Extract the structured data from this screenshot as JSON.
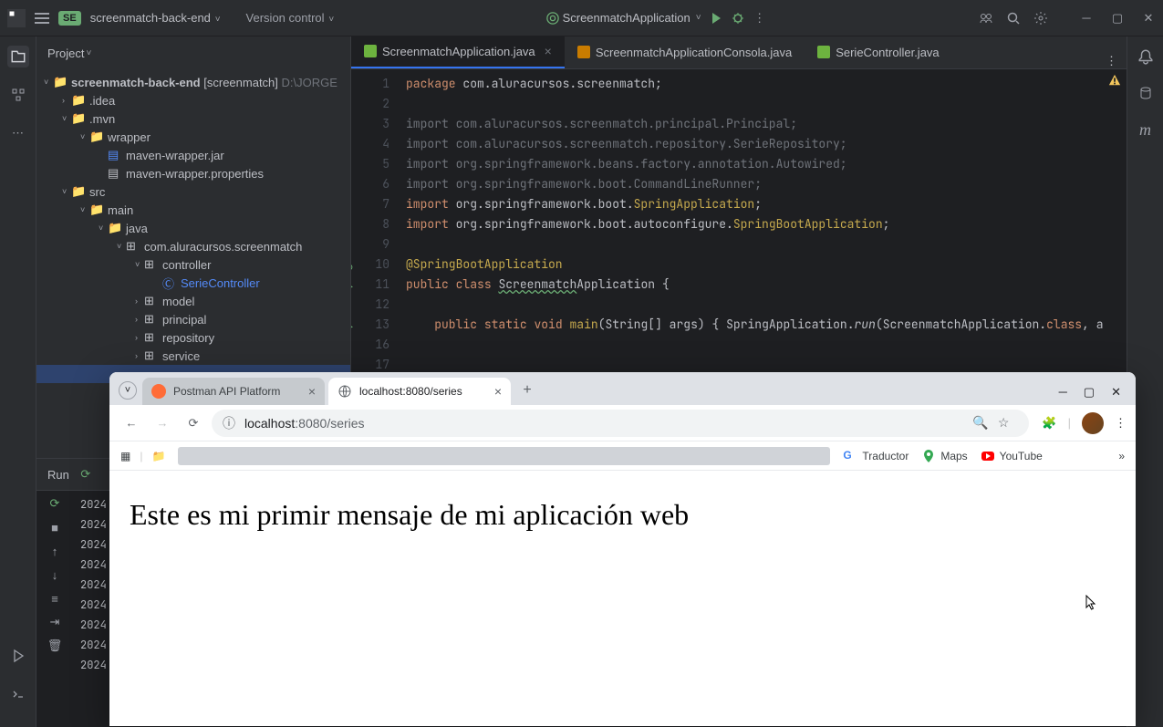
{
  "titlebar": {
    "se_badge": "SE",
    "project_name": "screenmatch-back-end",
    "version_control": "Version control",
    "run_config": "ScreenmatchApplication"
  },
  "project_panel": {
    "header": "Project",
    "root_name": "screenmatch-back-end",
    "root_suffix": "[screenmatch]",
    "root_path": "D:\\JORGE",
    "tree": {
      "idea": ".idea",
      "mvn": ".mvn",
      "wrapper": "wrapper",
      "maven_jar": "maven-wrapper.jar",
      "maven_props": "maven-wrapper.properties",
      "src": "src",
      "main": "main",
      "java": "java",
      "pkg": "com.aluracursos.screenmatch",
      "controller": "controller",
      "serie_controller": "SerieController",
      "model": "model",
      "principal": "principal",
      "repository": "repository",
      "service": "service"
    }
  },
  "editor_tabs": {
    "tab1": "ScreenmatchApplication.java",
    "tab2": "ScreenmatchApplicationConsola.java",
    "tab3": "SerieController.java"
  },
  "code": {
    "l1_kw": "package",
    "l1_pkg": " com.aluracursos.screenmatch",
    "l1_semi": ";",
    "l3": "import com.aluracursos.screenmatch.principal.Principal;",
    "l4": "import com.aluracursos.screenmatch.repository.SerieRepository;",
    "l5": "import org.springframework.beans.factory.annotation.Autowired;",
    "l6": "import org.springframework.boot.CommandLineRunner;",
    "l7_kw": "import",
    "l7_pkg": " org.springframework.boot.",
    "l7_cls": "SpringApplication",
    "l7_semi": ";",
    "l8_kw": "import",
    "l8_pkg": " org.springframework.boot.autoconfigure.",
    "l8_cls": "SpringBootApplication",
    "l8_semi": ";",
    "l10": "@SpringBootApplication",
    "l11_pub": "public",
    "l11_class": "class",
    "l11_name": "Screenmatch",
    "l11_name2": "Application",
    "l11_brace": " {",
    "l13_pub": "public",
    "l13_static": "static",
    "l13_void": "void",
    "l13_main": "main",
    "l13_args": "(String[] args)",
    "l13_brace": " {",
    "l13_call": " SpringApplication.",
    "l13_run": "run",
    "l13_rest": "(ScreenmatchApplication.",
    "l13_class": "class",
    "l13_end": ", a",
    "lines": [
      "1",
      "2",
      "3",
      "4",
      "5",
      "6",
      "7",
      "8",
      "9",
      "10",
      "11",
      "12",
      "13",
      "16",
      "17"
    ]
  },
  "run_panel": {
    "title": "Run",
    "log_year": "2024"
  },
  "browser": {
    "tab1_title": "Postman API Platform",
    "tab2_title": "localhost:8080/series",
    "url_host": "localhost",
    "url_port": ":8080",
    "url_path": "/series",
    "bookmarks": {
      "traductor": "Traductor",
      "maps": "Maps",
      "youtube": "YouTube"
    },
    "page_text": "Este es mi primir mensaje de mi aplicación web"
  }
}
